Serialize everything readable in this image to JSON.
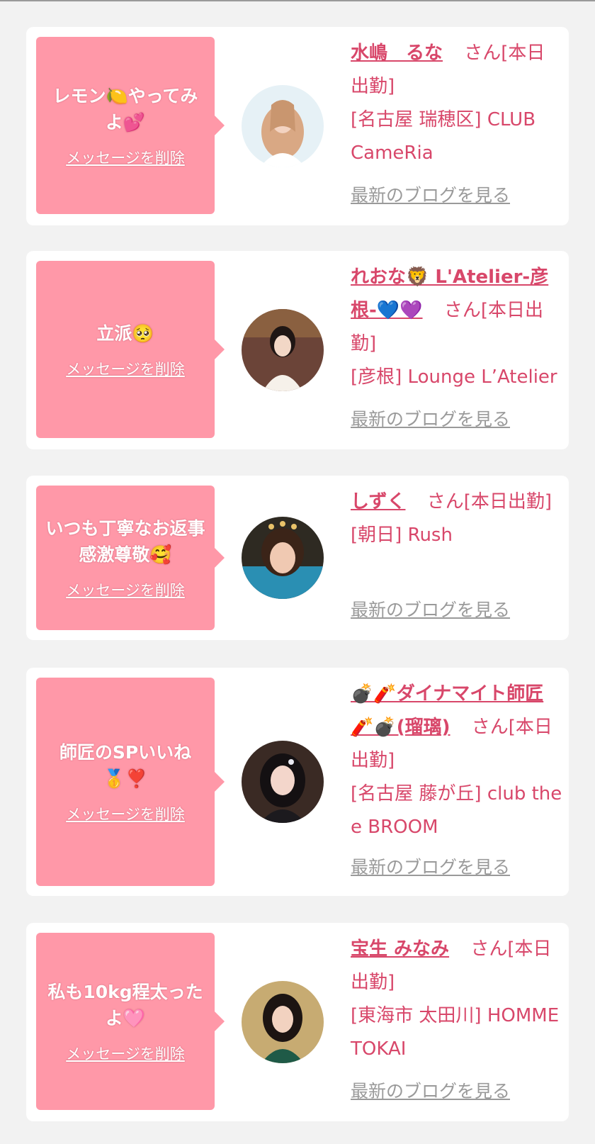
{
  "items": [
    {
      "message": "レモン🍋やってみよ💕",
      "delete_label": "メッセージを削除",
      "name": "水嶋　るな",
      "status": "さん[本日出勤]",
      "shop": "[名古屋 瑞穂区] CLUB CameRia",
      "blog_label": "最新のブログを見る"
    },
    {
      "message": "立派🥺",
      "delete_label": "メッセージを削除",
      "name": "れおな🦁 L'Atelier-彦根-💙💜",
      "status": "さん[本日出勤]",
      "shop": "[彦根] Lounge L’Atelier",
      "blog_label": "最新のブログを見る"
    },
    {
      "message": "いつも丁寧なお返事感激尊敬🥰",
      "delete_label": "メッセージを削除",
      "name": "しずく",
      "status": "さん[本日出勤]",
      "shop": "[朝日] Rush",
      "blog_label": "最新のブログを見る"
    },
    {
      "message": "師匠のSPいいね🥇❣️",
      "delete_label": "メッセージを削除",
      "name": "💣🧨ダイナマイト師匠🧨💣(瑠璃)",
      "status": "さん[本日出勤]",
      "shop": "[名古屋 藤が丘] club the e BROOM",
      "blog_label": "最新のブログを見る"
    },
    {
      "message": "私も10kg程太ったよ🩷",
      "delete_label": "メッセージを削除",
      "name": "宝生 みなみ",
      "status": "さん[本日出勤]",
      "shop": "[東海市 太田川] HOMME TOKAI",
      "blog_label": "最新のブログを見る"
    }
  ],
  "colors": {
    "accent": "#d8476a",
    "bubble": "#ff98a8",
    "muted": "#9a9a9a",
    "background": "#f2f2f2"
  }
}
